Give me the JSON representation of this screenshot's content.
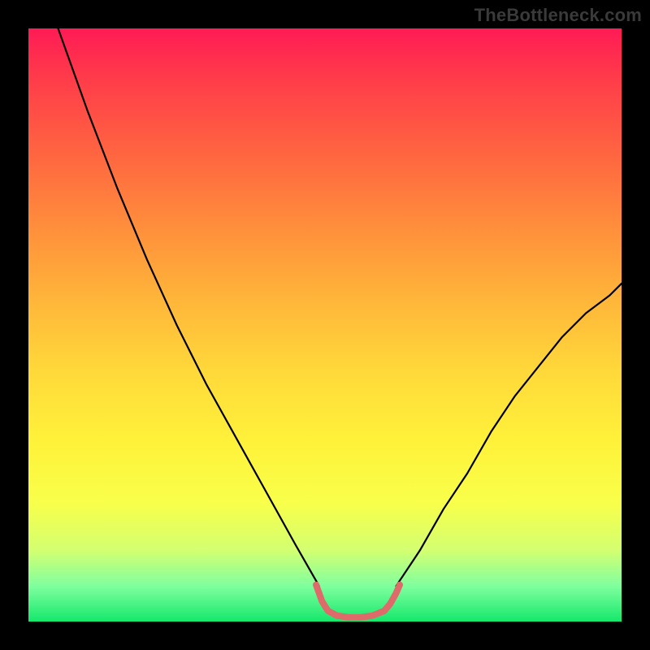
{
  "watermark": "TheBottleneck.com",
  "chart_data": {
    "type": "line",
    "title": "",
    "xlabel": "",
    "ylabel": "",
    "xlim": [
      0,
      100
    ],
    "ylim": [
      0,
      100
    ],
    "grid": false,
    "legend": false,
    "annotations": [],
    "background_gradient_stops": [
      {
        "pos": 0.0,
        "color": "#ff1b55"
      },
      {
        "pos": 0.08,
        "color": "#ff3a4a"
      },
      {
        "pos": 0.22,
        "color": "#ff6840"
      },
      {
        "pos": 0.35,
        "color": "#ff933b"
      },
      {
        "pos": 0.46,
        "color": "#ffb63a"
      },
      {
        "pos": 0.58,
        "color": "#ffd93a"
      },
      {
        "pos": 0.7,
        "color": "#fff23a"
      },
      {
        "pos": 0.8,
        "color": "#f8ff4a"
      },
      {
        "pos": 0.88,
        "color": "#d3ff70"
      },
      {
        "pos": 0.94,
        "color": "#7fff9e"
      },
      {
        "pos": 1.0,
        "color": "#14e86b"
      }
    ],
    "series": [
      {
        "name": "black-curve-left",
        "stroke": "#000000",
        "width": 2.2,
        "x": [
          5,
          10,
          15,
          20,
          25,
          30,
          35,
          40,
          45,
          49
        ],
        "y": [
          100,
          86,
          73,
          61,
          50,
          40,
          31,
          22,
          13,
          6
        ]
      },
      {
        "name": "black-curve-right",
        "stroke": "#000000",
        "width": 2.2,
        "x": [
          62,
          66,
          70,
          74,
          78,
          82,
          86,
          90,
          94,
          98,
          100
        ],
        "y": [
          6,
          12,
          19,
          25,
          32,
          38,
          43,
          48,
          52,
          55,
          57
        ]
      },
      {
        "name": "red-notch-bottom",
        "stroke": "#de6a6a",
        "width": 8,
        "x": [
          48.5,
          49.5,
          50.5,
          52,
          54,
          56,
          58,
          60,
          61,
          62,
          62.6
        ],
        "y": [
          6.2,
          3.4,
          1.8,
          1.0,
          0.7,
          0.7,
          1.0,
          1.8,
          3.0,
          4.8,
          6.2
        ]
      }
    ]
  }
}
